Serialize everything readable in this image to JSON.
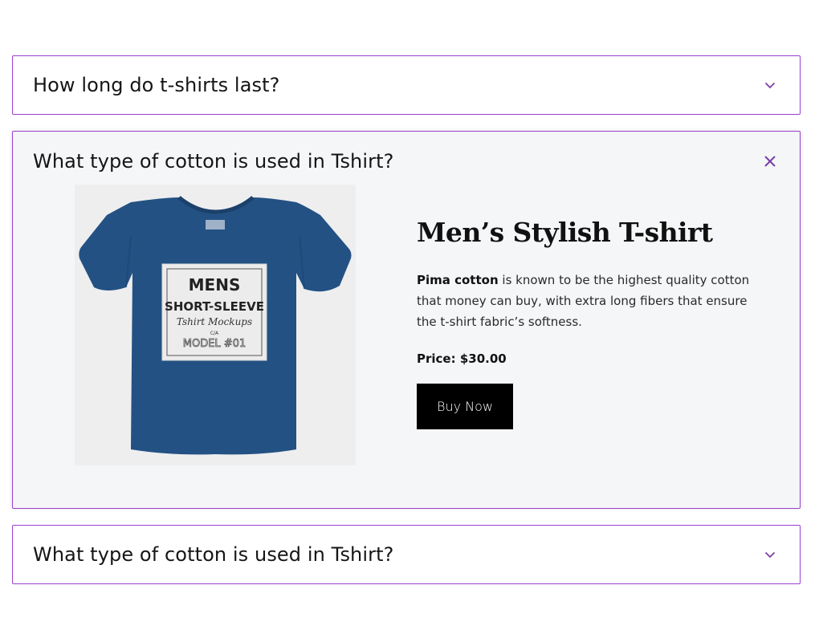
{
  "faq": [
    {
      "question": "How long do t-shirts last?",
      "expanded": false,
      "icon": "chevron-down-icon"
    },
    {
      "question": "What type of cotton is used in Tshirt?",
      "expanded": true,
      "icon": "close-icon",
      "product": {
        "image_icon": "tshirt-mockup-image",
        "shirt_text": {
          "line1": "MENS",
          "line2": "SHORT-SLEEVE",
          "line3": "Tshirt Mockups",
          "line4": "C/A",
          "line5": "MODEL #01"
        },
        "title": "Men’s Stylish T-shirt",
        "desc_bold": "Pima cotton",
        "desc_rest": " is known to be the highest quality cotton that money can buy, with extra long fibers that ensure the t-shirt fabric’s softness.",
        "price_label": "Price:",
        "price_value": "$30.00",
        "buy_label": "Buy Now"
      }
    },
    {
      "question": "What type of cotton is used in Tshirt?",
      "expanded": false,
      "icon": "chevron-down-icon"
    }
  ],
  "colors": {
    "accent": "#9b3fd0",
    "icon": "#7a3fa8",
    "shirt": "#235183",
    "button": "#000000"
  }
}
